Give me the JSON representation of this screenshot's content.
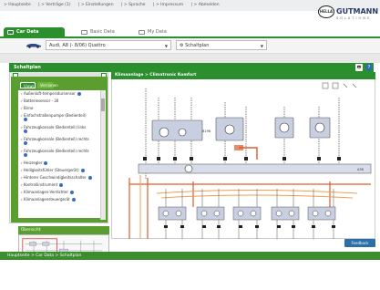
{
  "topnav": {
    "items": [
      "> Hauptseite",
      "| > Verträge (1)",
      "| > Einstellungen",
      "| > Sprache",
      "| > Impressum",
      "| > Abmelden"
    ]
  },
  "logo": {
    "brand": "GUTMANN",
    "sub": "SOLUTIONS",
    "badge": "HELLA"
  },
  "tabs": [
    {
      "label": "Car Data",
      "active": true
    },
    {
      "label": "Basic Data",
      "active": false
    },
    {
      "label": "My Data",
      "active": false
    }
  ],
  "vehicle": {
    "model": "Audi, A8 (- 8/06) Quattro",
    "mode": "Schaltplan"
  },
  "panel": {
    "title": "Schaltplan"
  },
  "sidebar": {
    "filter_tabs": [
      "Views",
      "Versionen"
    ],
    "items": [
      "Außenluft-temperatursensor",
      "Batteriesensor - 30",
      "Birne",
      "Einfachstraßenpumpe (Bedienteil)",
      "Fahrzeugkonsole (Bedienteil) links",
      "Fahrzeugkonsole (Bedienteil) rechts",
      "Fahrzeugkonsole (Bedienteil) rechts",
      "Heizregler",
      "Helligkeitsfühler (Steuergerät)",
      "Hinterer Geschwindigkeitsschalter",
      "Kontrollinstrument",
      "Klimaanlagen-Verdichter",
      "Klimaanlagensteuergerät"
    ]
  },
  "overview": {
    "title": "Übersicht"
  },
  "diagram": {
    "title": "Klimaanlage > Climatronic Komfort",
    "labels": {
      "top": "B196",
      "bus1": "A38"
    }
  },
  "feedback": {
    "label": "Feedback"
  },
  "footer": {
    "breadcrumb": "Hauptseite > Car Data > Schaltplan"
  },
  "colors": {
    "green": "#2b8f2e",
    "sidebar": "#5a9e2f",
    "wire_red": "#e05a2a",
    "wire_orange": "#f0a050",
    "component": "#c8cfe0"
  }
}
